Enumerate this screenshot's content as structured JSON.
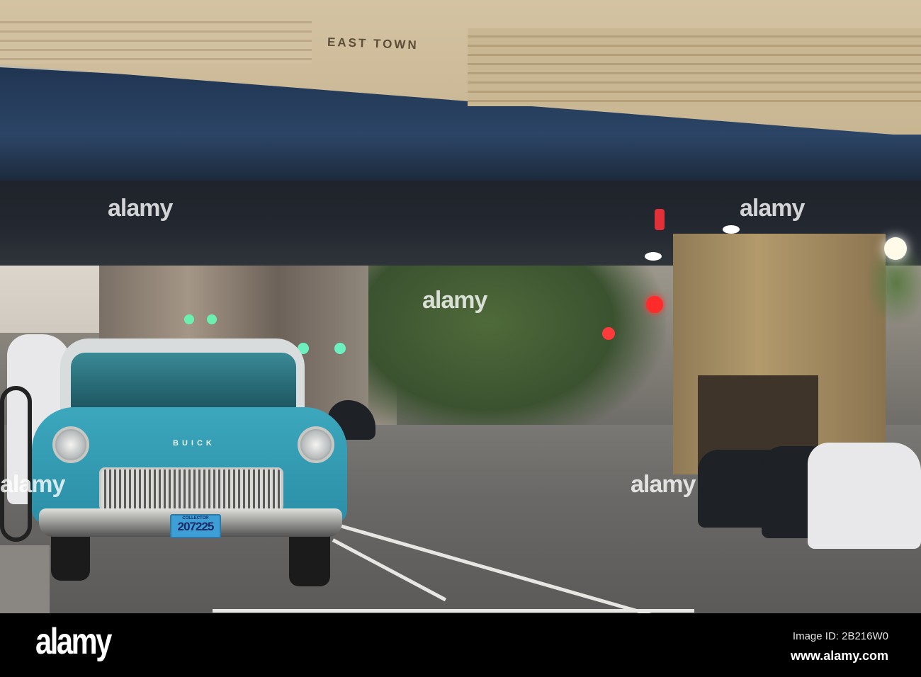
{
  "scene": {
    "bridge_sign": "EAST TOWN",
    "hood_badge": "BUICK",
    "license_plate": {
      "top_text": "COLLECTOR",
      "number": "207225"
    },
    "car_color": "#2f9ab2"
  },
  "watermark": {
    "text": "alamy"
  },
  "footer": {
    "logo": "alamy",
    "image_id": "Image ID: 2B216W0",
    "website": "www.alamy.com"
  }
}
